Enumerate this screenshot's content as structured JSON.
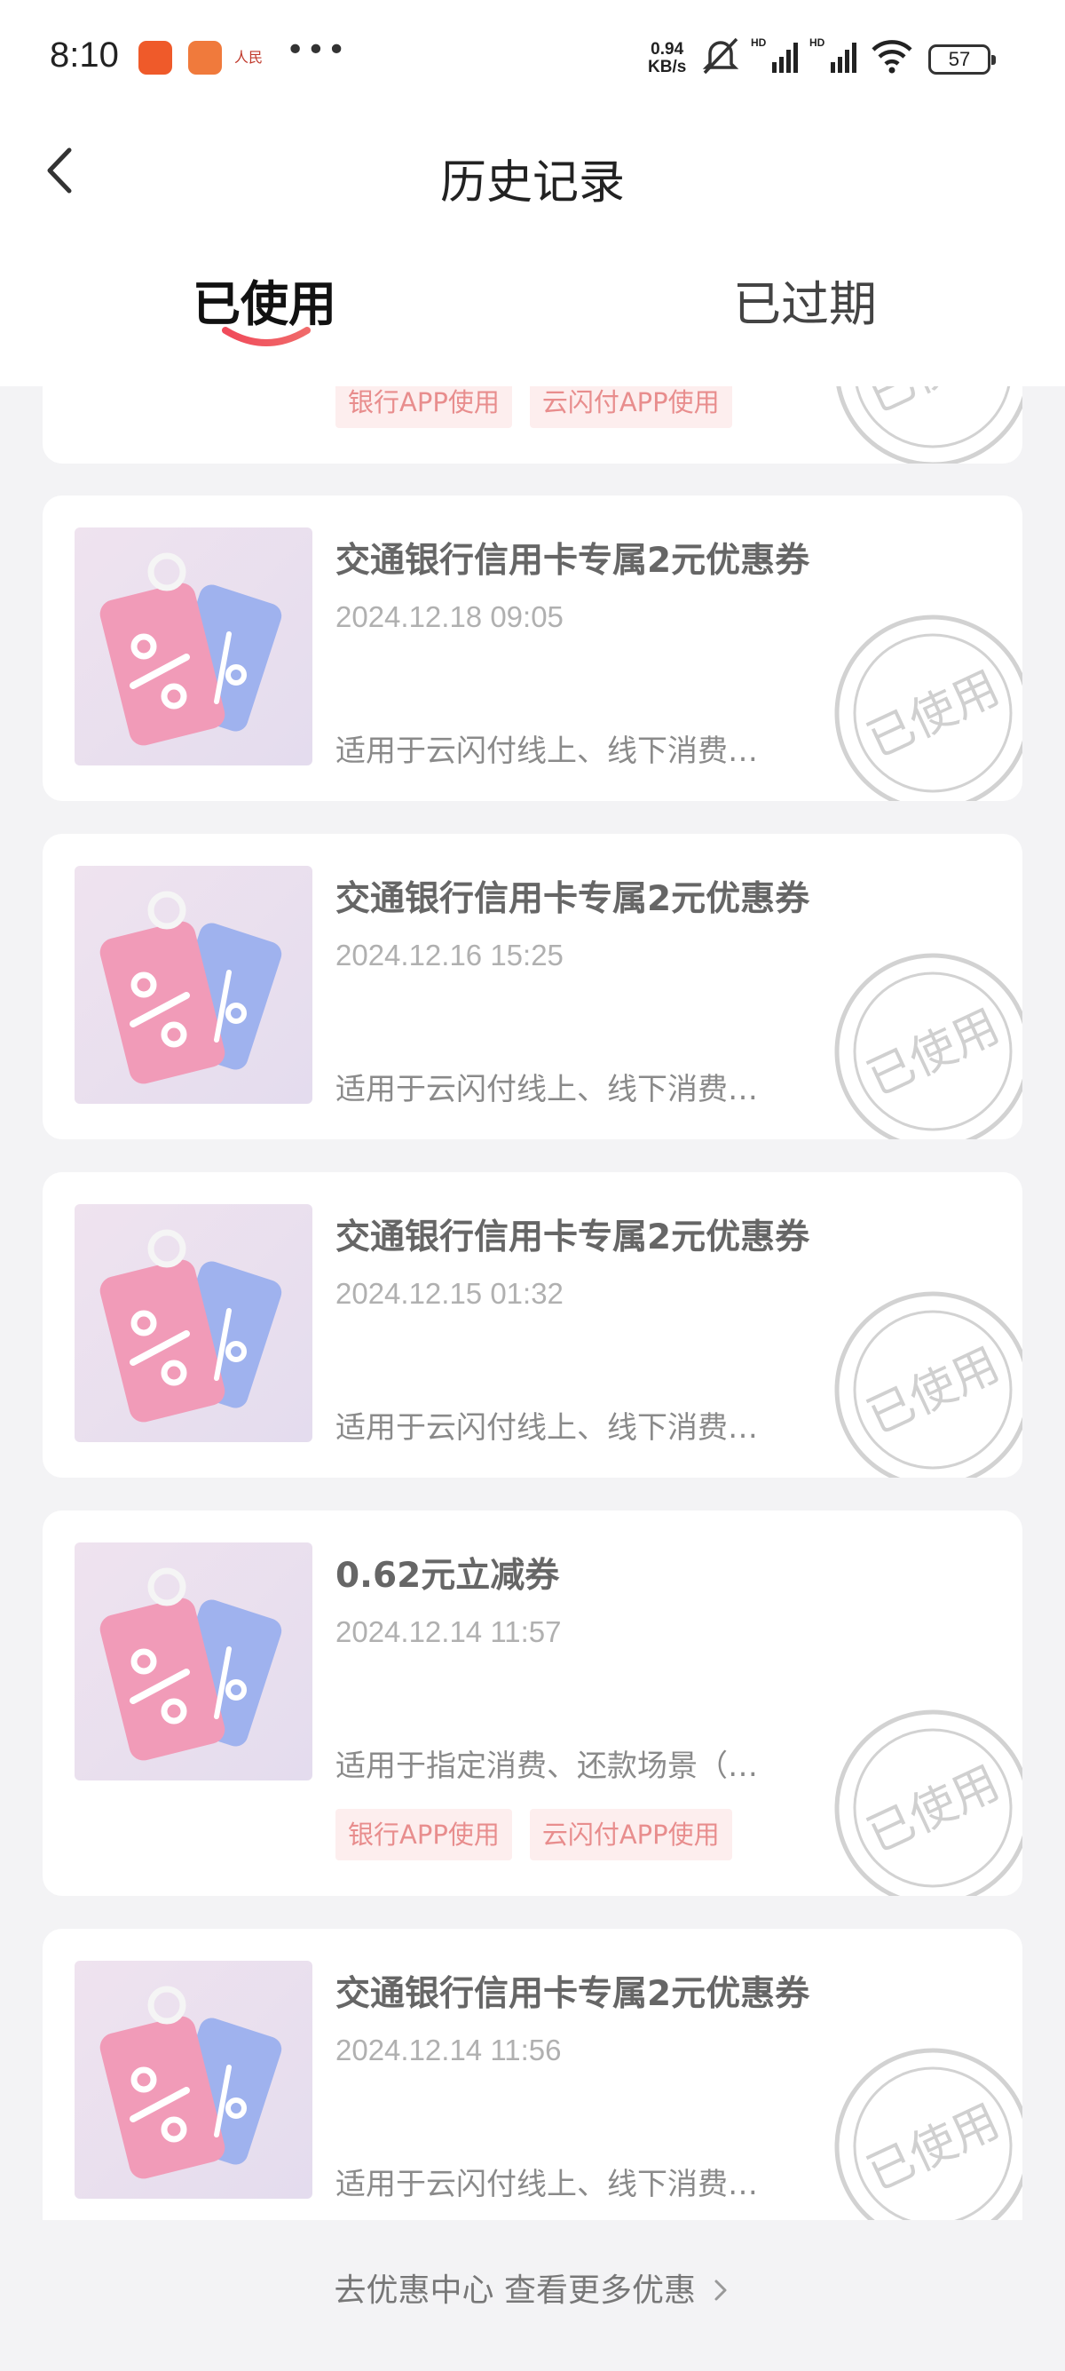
{
  "status_bar": {
    "time": "8:10",
    "speed_value": "0.94",
    "speed_unit": "KB/s",
    "battery": "57"
  },
  "header": {
    "title": "历史记录"
  },
  "tabs": [
    {
      "label": "已使用",
      "active": true
    },
    {
      "label": "已过期",
      "active": false
    }
  ],
  "partial_card": {
    "tags": [
      "银行APP使用",
      "云闪付APP使用"
    ]
  },
  "coupons": [
    {
      "title": "交通银行信用卡专属2元优惠券",
      "date": "2024.12.18 09:05",
      "desc": "适用于云闪付线上、线下消费…",
      "tags": []
    },
    {
      "title": "交通银行信用卡专属2元优惠券",
      "date": "2024.12.16 15:25",
      "desc": "适用于云闪付线上、线下消费…",
      "tags": []
    },
    {
      "title": "交通银行信用卡专属2元优惠券",
      "date": "2024.12.15 01:32",
      "desc": "适用于云闪付线上、线下消费…",
      "tags": []
    },
    {
      "title": "0.62元立减券",
      "date": "2024.12.14 11:57",
      "desc": "适用于指定消费、还款场景（…",
      "tags": [
        "银行APP使用",
        "云闪付APP使用"
      ]
    },
    {
      "title": "交通银行信用卡专属2元优惠券",
      "date": "2024.12.14 11:56",
      "desc": "适用于云闪付线上、线下消费…",
      "tags": []
    }
  ],
  "stamp_text": "已使用",
  "footer": {
    "link": "去优惠中心 查看更多优惠"
  },
  "colors": {
    "accent": "#f0465a",
    "stamp": "#d0d0d0",
    "tag_bg": "#fdeeee",
    "tag_text": "#e88d8d"
  },
  "icons": {
    "back": "chevron-left-icon",
    "footer_arrow": "chevron-right-icon",
    "coupon_thumb": "discount-tag-icon",
    "stamp": "used-stamp-icon"
  }
}
